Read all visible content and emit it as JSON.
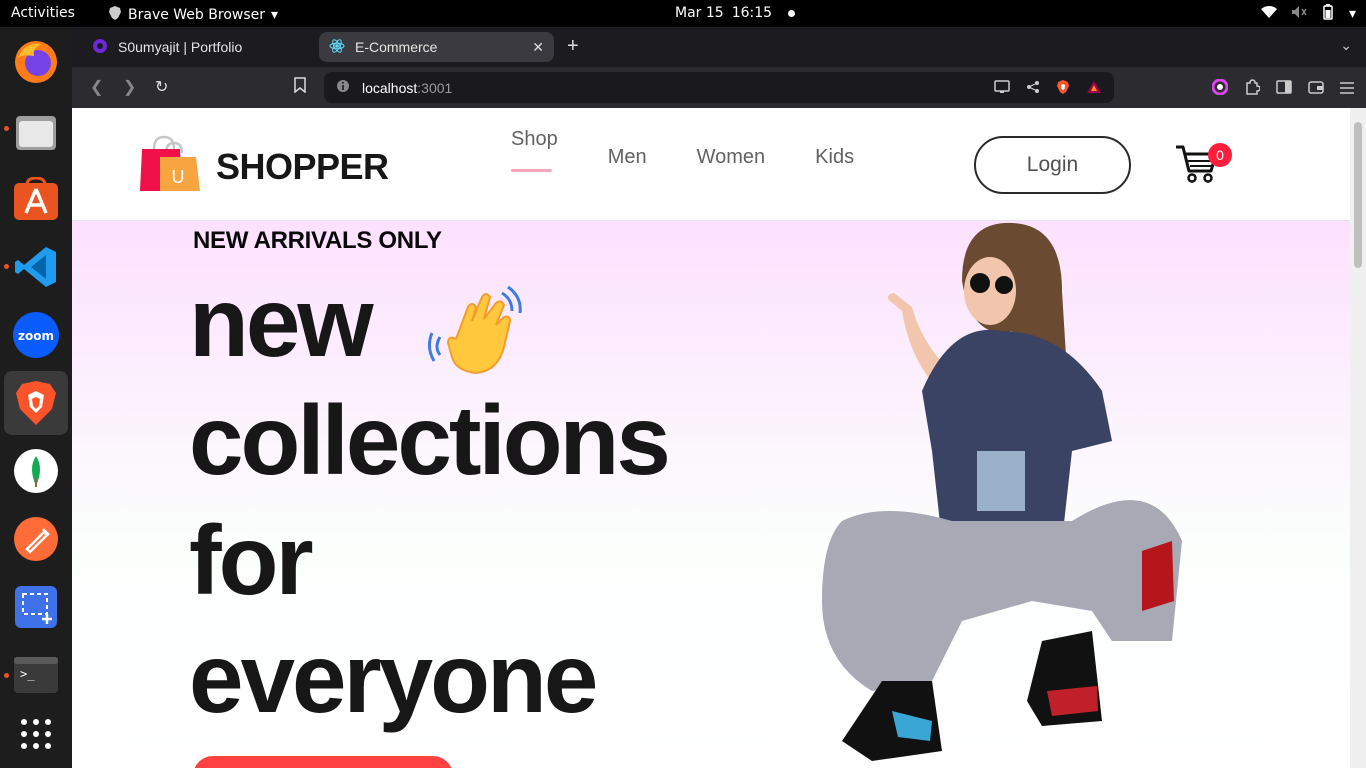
{
  "system": {
    "activities": "Activities",
    "app_name": "Brave Web Browser",
    "date": "Mar 15",
    "time": "16:15"
  },
  "dock": {
    "apps": [
      "firefox-icon",
      "files-icon",
      "app-center-icon",
      "vscode-icon",
      "zoom-icon",
      "brave-icon",
      "mongodb-compass-icon",
      "postman-icon",
      "screenshot-icon",
      "terminal-icon",
      "show-apps-icon"
    ],
    "zoom_label": "zoom"
  },
  "browser": {
    "tabs": [
      {
        "title": "S0umyajit | Portfolio"
      },
      {
        "title": "E-Commerce"
      }
    ],
    "url_host": "localhost",
    "url_port": ":3001"
  },
  "site": {
    "brand": "SHOPPER",
    "logo_letter": "U",
    "menu": [
      "Shop",
      "Men",
      "Women",
      "Kids"
    ],
    "login_label": "Login",
    "cart_count": "0"
  },
  "hero": {
    "eyebrow": "NEW ARRIVALS ONLY",
    "line1": "new",
    "line2": "collections",
    "line3": "for",
    "line4": "everyone"
  },
  "colors": {
    "accent": "#ff4141",
    "badge": "#ff1e3c",
    "hero_top": "#fde1ff",
    "active_underline": "#f4a5b9"
  }
}
